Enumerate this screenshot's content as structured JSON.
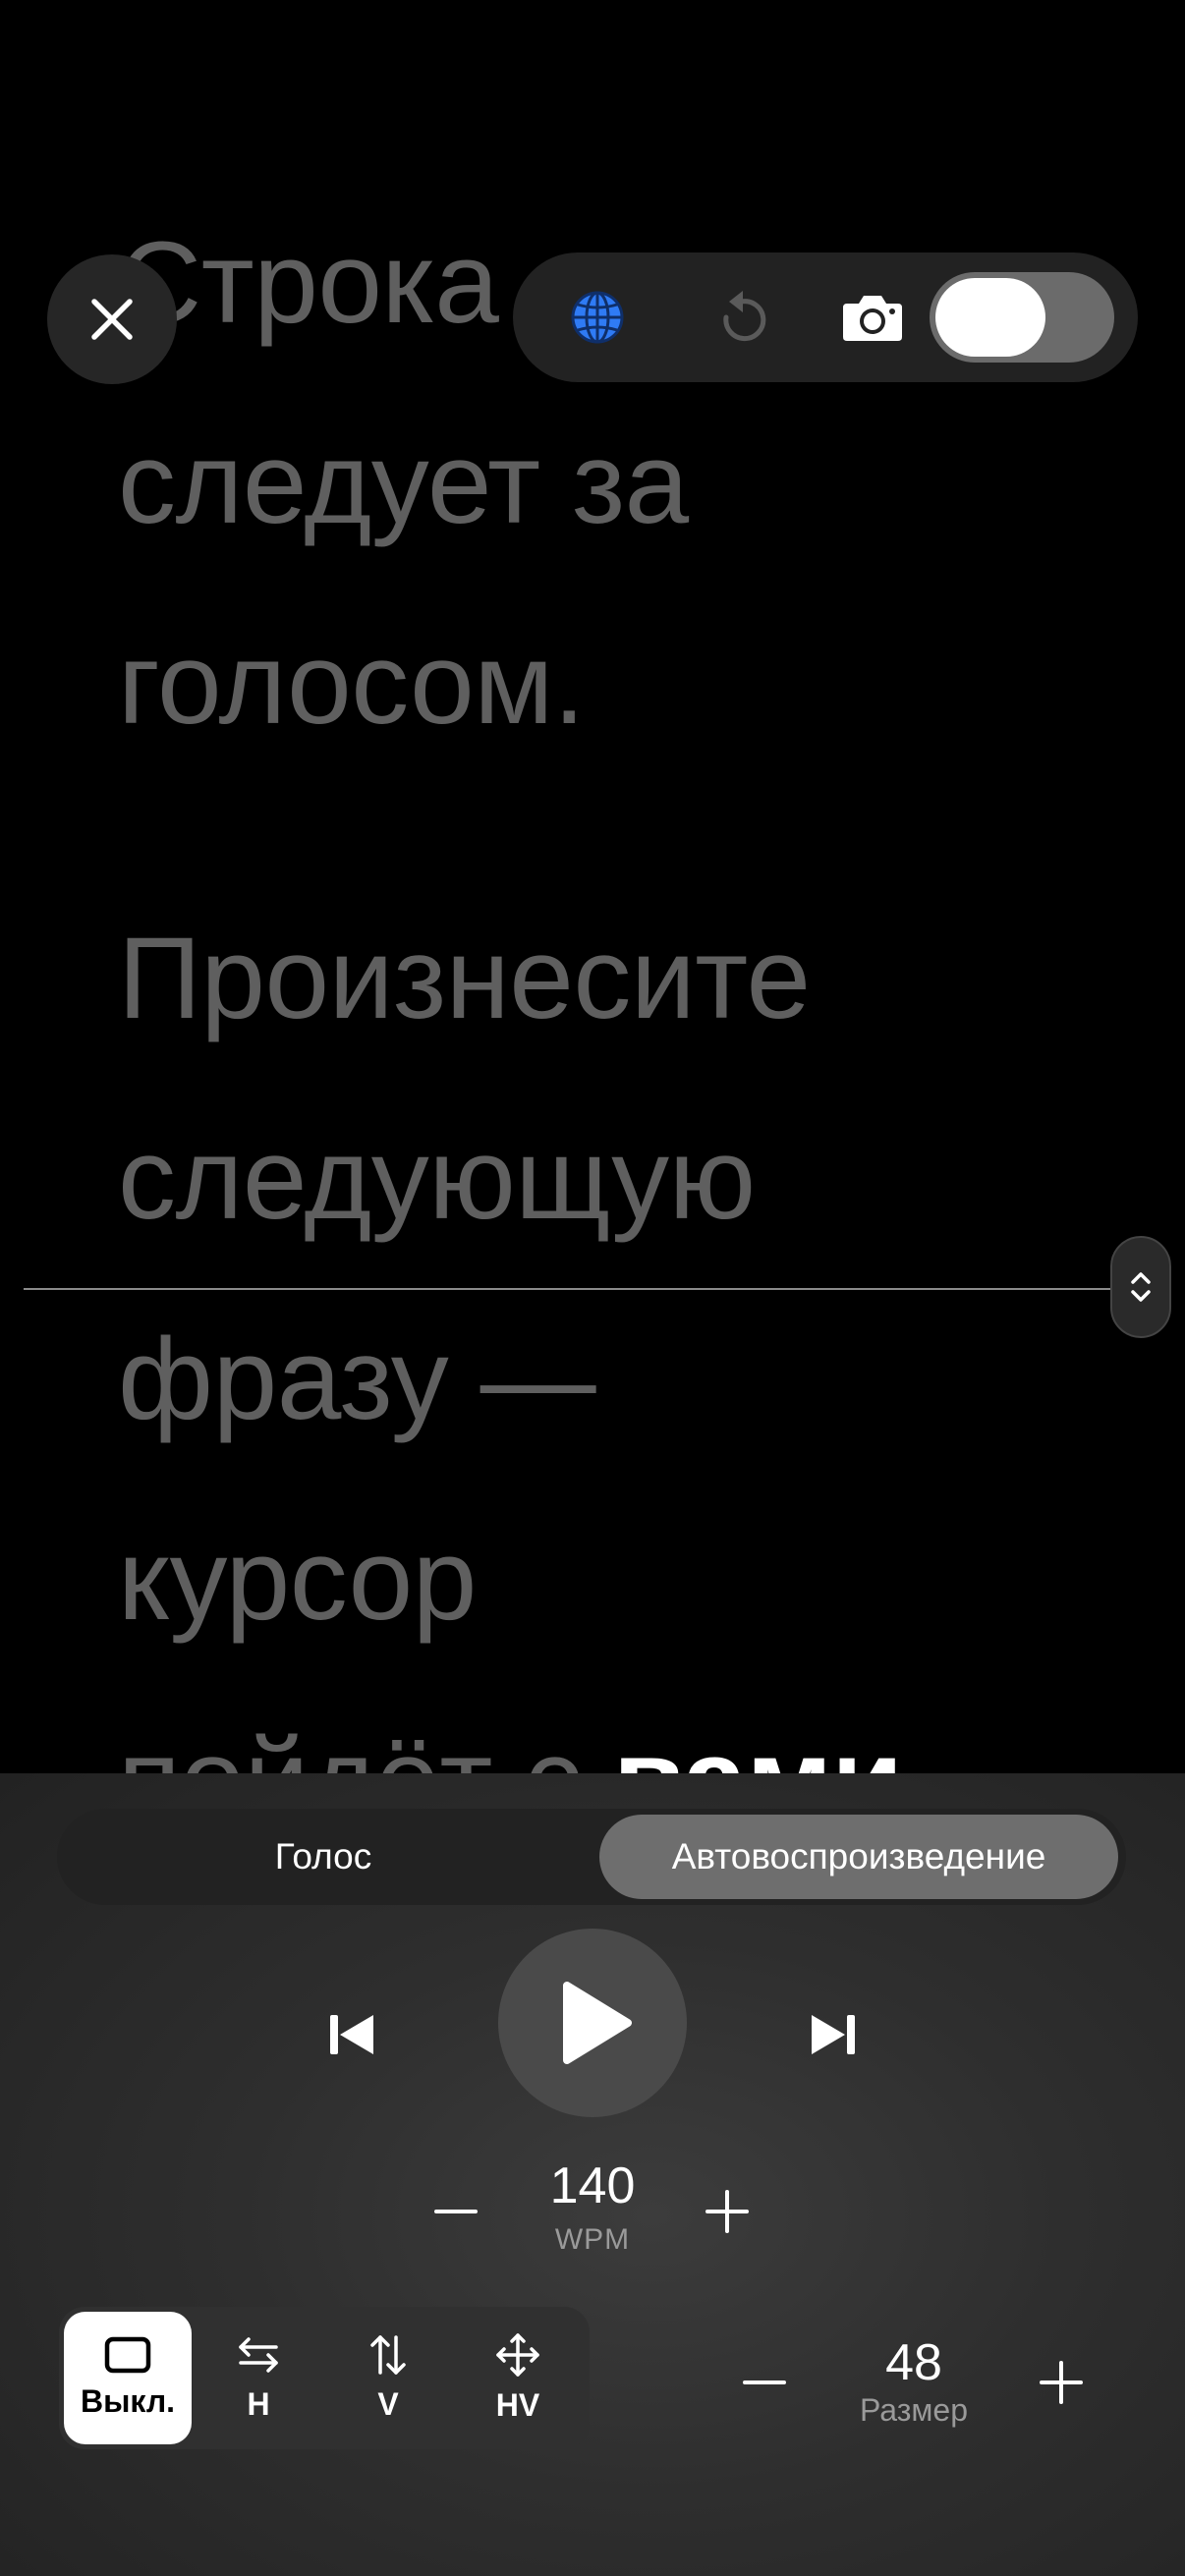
{
  "prompter": {
    "lines": [
      "Строка",
      "следует за",
      "голосом.",
      "Произнесите",
      "следующую",
      "фразу —",
      "курсор"
    ],
    "partial_line": {
      "dim": "пойдёт с ",
      "highlight": "вами"
    }
  },
  "top_bar": {
    "close_icon": "close-icon",
    "language_icon": "globe-icon",
    "reset_icon": "rotate-left-icon",
    "camera_icon": "camera-icon",
    "camera_toggle_on": true
  },
  "mode_tabs": {
    "voice": "Голос",
    "autoplay": "Автовоспроизведение",
    "selected": "autoplay"
  },
  "playback": {
    "prev_icon": "skip-back-icon",
    "play_icon": "play-icon",
    "next_icon": "skip-forward-icon"
  },
  "speed": {
    "value": "140",
    "unit": "WPM"
  },
  "mirror": {
    "items": [
      {
        "label": "Выкл.",
        "icon": "rectangle-icon",
        "selected": true
      },
      {
        "label": "H",
        "icon": "arrows-left-right-icon",
        "selected": false
      },
      {
        "label": "V",
        "icon": "arrows-up-down-icon",
        "selected": false
      },
      {
        "label": "HV",
        "icon": "arrows-move-icon",
        "selected": false
      }
    ]
  },
  "size": {
    "value": "48",
    "label": "Размер"
  },
  "colors": {
    "accent_blue": "#2f7bf5",
    "background": "#000000",
    "dim_text": "#5f5f5f"
  }
}
